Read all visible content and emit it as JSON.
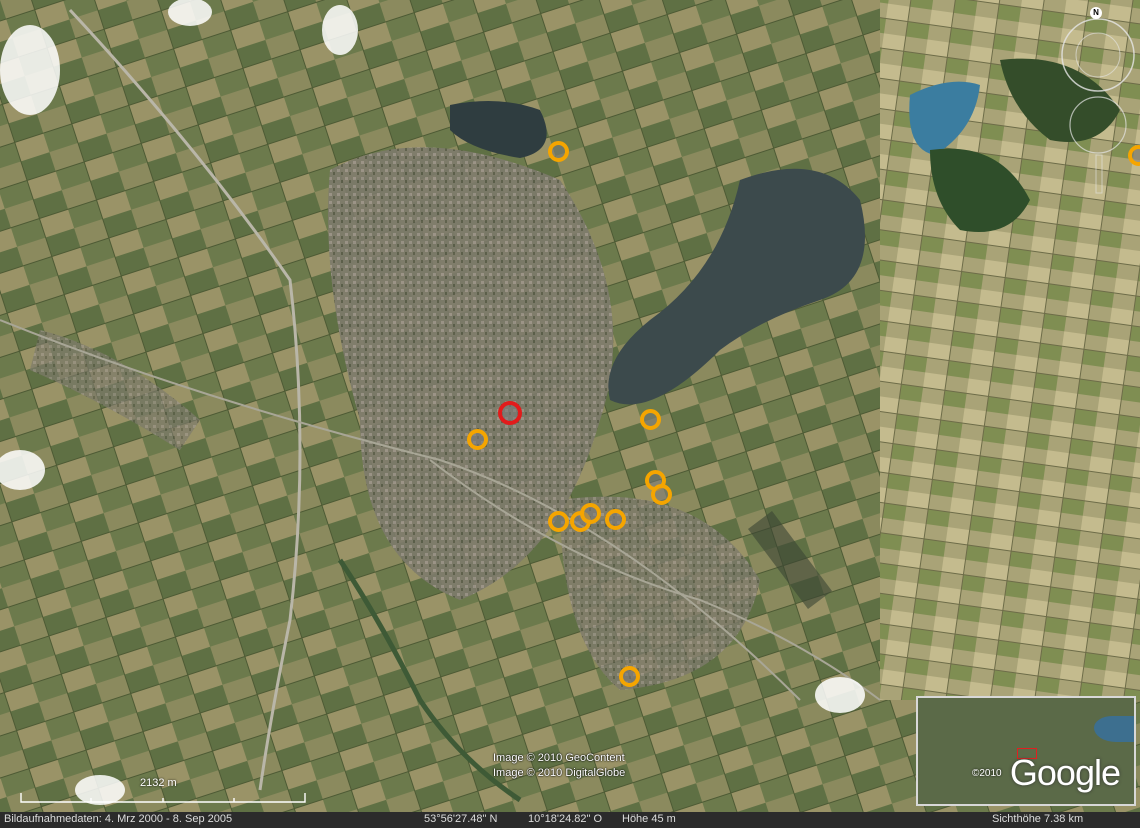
{
  "imagery": {
    "copyright_lines": [
      "Image © 2010 GeoContent",
      "Image © 2010 DigitalGlobe"
    ]
  },
  "scale": {
    "label": "2132  m"
  },
  "status": {
    "dates": "Bildaufnahmedaten:  4. Mrz 2000 - 8. Sep 2005",
    "lat": "53°56'27.48\" N",
    "lon": "10°18'24.82\" O",
    "elevation": "Höhe   45 m",
    "eye_alt": "Sichthöhe     7.38 km"
  },
  "overview": {
    "logo": "Google",
    "year": "©2010"
  },
  "navigation": {
    "north_label": "N"
  },
  "colors": {
    "marker": "#f5a500",
    "selected_marker": "#e21b1b",
    "lake": "#334a55"
  },
  "markers": [
    {
      "id": "placemark-1",
      "selected": false
    },
    {
      "id": "placemark-2",
      "selected": true
    },
    {
      "id": "placemark-3",
      "selected": false
    },
    {
      "id": "placemark-4",
      "selected": false
    },
    {
      "id": "placemark-5",
      "selected": false
    },
    {
      "id": "placemark-6",
      "selected": false
    },
    {
      "id": "placemark-7",
      "selected": false
    },
    {
      "id": "placemark-8",
      "selected": false
    },
    {
      "id": "placemark-9",
      "selected": false
    },
    {
      "id": "placemark-10",
      "selected": false
    },
    {
      "id": "placemark-11",
      "selected": false
    },
    {
      "id": "placemark-12",
      "selected": false
    }
  ]
}
